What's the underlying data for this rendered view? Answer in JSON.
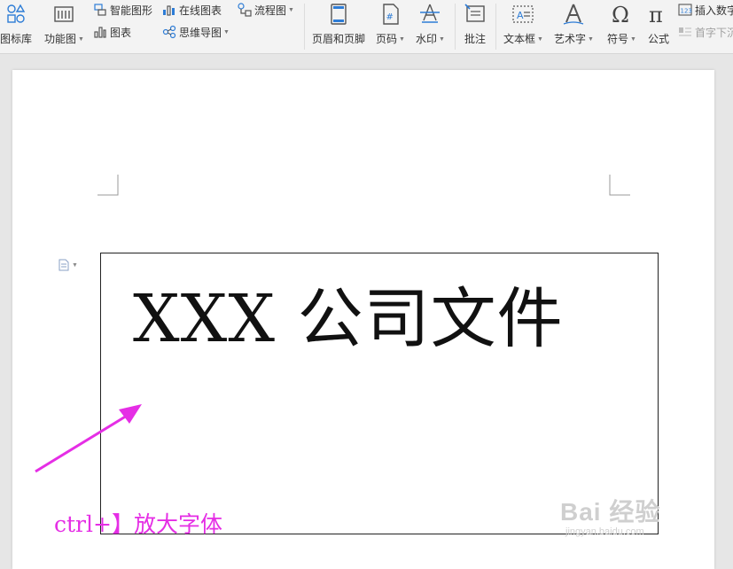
{
  "toolbar": {
    "icon_library": "图标库",
    "function_chart": "功能图",
    "smart_graphic": "智能图形",
    "chart": "图表",
    "online_chart": "在线图表",
    "mind_map": "思维导图",
    "flowchart": "流程图",
    "header_footer": "页眉和页脚",
    "page_number": "页码",
    "watermark": "水印",
    "comment": "批注",
    "text_box": "文本框",
    "word_art": "艺术字",
    "symbol": "符号",
    "formula": "公式",
    "insert_number": "插入数字",
    "drop_cap": "首字下沉"
  },
  "document": {
    "title": "XXX 公司文件",
    "instruction": "ctrl+】放大字体",
    "watermark_main": "Bai 经验",
    "watermark_url": "jingyan.baidu.com"
  },
  "colors": {
    "accent": "#2d7cd6",
    "annotation": "#e52ee5"
  }
}
